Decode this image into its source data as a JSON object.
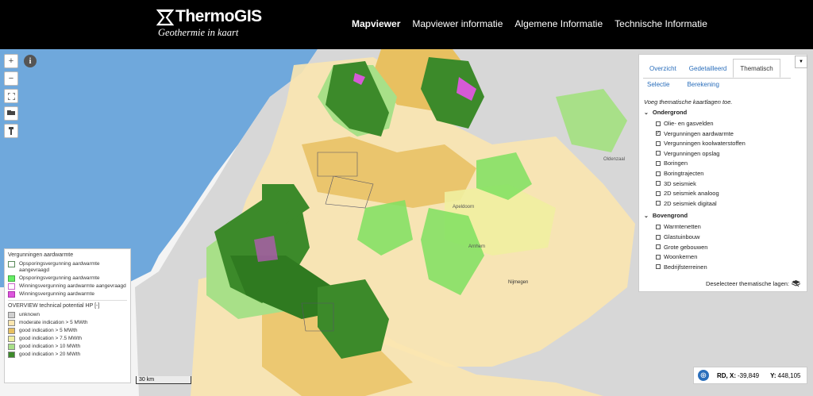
{
  "header": {
    "logo_title": "ThermoGIS",
    "logo_subtitle": "Geothermie in kaart",
    "nav": [
      "Mapviewer",
      "Mapviewer informatie",
      "Algemene Informatie",
      "Technische Informatie"
    ],
    "active_nav": "Mapviewer"
  },
  "map": {
    "info_glyph": "i",
    "place_labels": [
      "Apeldoorn",
      "Oldenzaal",
      "Nijmegen",
      "Arnhem"
    ],
    "scale_label": "30 km"
  },
  "legend": {
    "section1_title": "Vergunningen aardwarmte",
    "permits": [
      {
        "label": "Opsporingsvergunning aardwarmte aangevraagd",
        "fill": "#ffffff",
        "border": "#5a8a5a"
      },
      {
        "label": "Opsporingsvergunning aardwarmte",
        "fill": "#66ee66",
        "border": "#44aa44"
      },
      {
        "label": "Winningsvergunning aardwarmte aangevraagd",
        "fill": "#ffffff",
        "border": "#cc66cc"
      },
      {
        "label": "Winningsvergunning aardwarmte",
        "fill": "#dd55dd",
        "border": "#aa33aa"
      }
    ],
    "section2_title": "OVERVIEW technical potential HP [-]",
    "potential": [
      {
        "label": "unknown",
        "fill": "#d0d0d0"
      },
      {
        "label": "moderate indication > 5 MWth",
        "fill": "#fbe6b0"
      },
      {
        "label": "good indication > 5 MWth",
        "fill": "#e8c060"
      },
      {
        "label": "good indication > 7.5 MWth",
        "fill": "#f0eea0"
      },
      {
        "label": "good indication > 10 MWth",
        "fill": "#a8e088"
      },
      {
        "label": "good indication > 20 MWth",
        "fill": "#3c8a2a"
      }
    ]
  },
  "panel": {
    "tabs": [
      "Overzicht",
      "Gedetailleerd",
      "Thematisch"
    ],
    "active_tab": "Thematisch",
    "subtabs": [
      "Selectie",
      "Berekening"
    ],
    "intro": "Voeg thematische kaartlagen toe.",
    "sections": [
      {
        "title": "Ondergrond",
        "layers": [
          {
            "label": "Olie- en gasvelden",
            "checked": false
          },
          {
            "label": "Vergunningen aardwarmte",
            "checked": true
          },
          {
            "label": "Vergunningen koolwaterstoffen",
            "checked": false
          },
          {
            "label": "Vergunningen opslag",
            "checked": false
          },
          {
            "label": "Boringen",
            "checked": false
          },
          {
            "label": "Boringtrajecten",
            "checked": false
          },
          {
            "label": "3D seismiek",
            "checked": false
          },
          {
            "label": "2D seismiek analoog",
            "checked": false
          },
          {
            "label": "2D seismiek digitaal",
            "checked": false
          }
        ]
      },
      {
        "title": "Bovengrond",
        "layers": [
          {
            "label": "Warmtenetten",
            "checked": false
          },
          {
            "label": "Glastuinbouw",
            "checked": false
          },
          {
            "label": "Grote gebouwen",
            "checked": false
          },
          {
            "label": "Woonkernen",
            "checked": false
          },
          {
            "label": "Bedrijfsterreinen",
            "checked": false
          }
        ]
      }
    ],
    "deselect_label": "Deselecteer thematische lagen:"
  },
  "coords": {
    "x_label": "RD, X:",
    "x_value": "-39,849",
    "y_label": "Y:",
    "y_value": "448,105"
  },
  "colors": {
    "sea": "#6fa8dc",
    "land": "#d9d9d9",
    "link": "#2a6ebb"
  }
}
